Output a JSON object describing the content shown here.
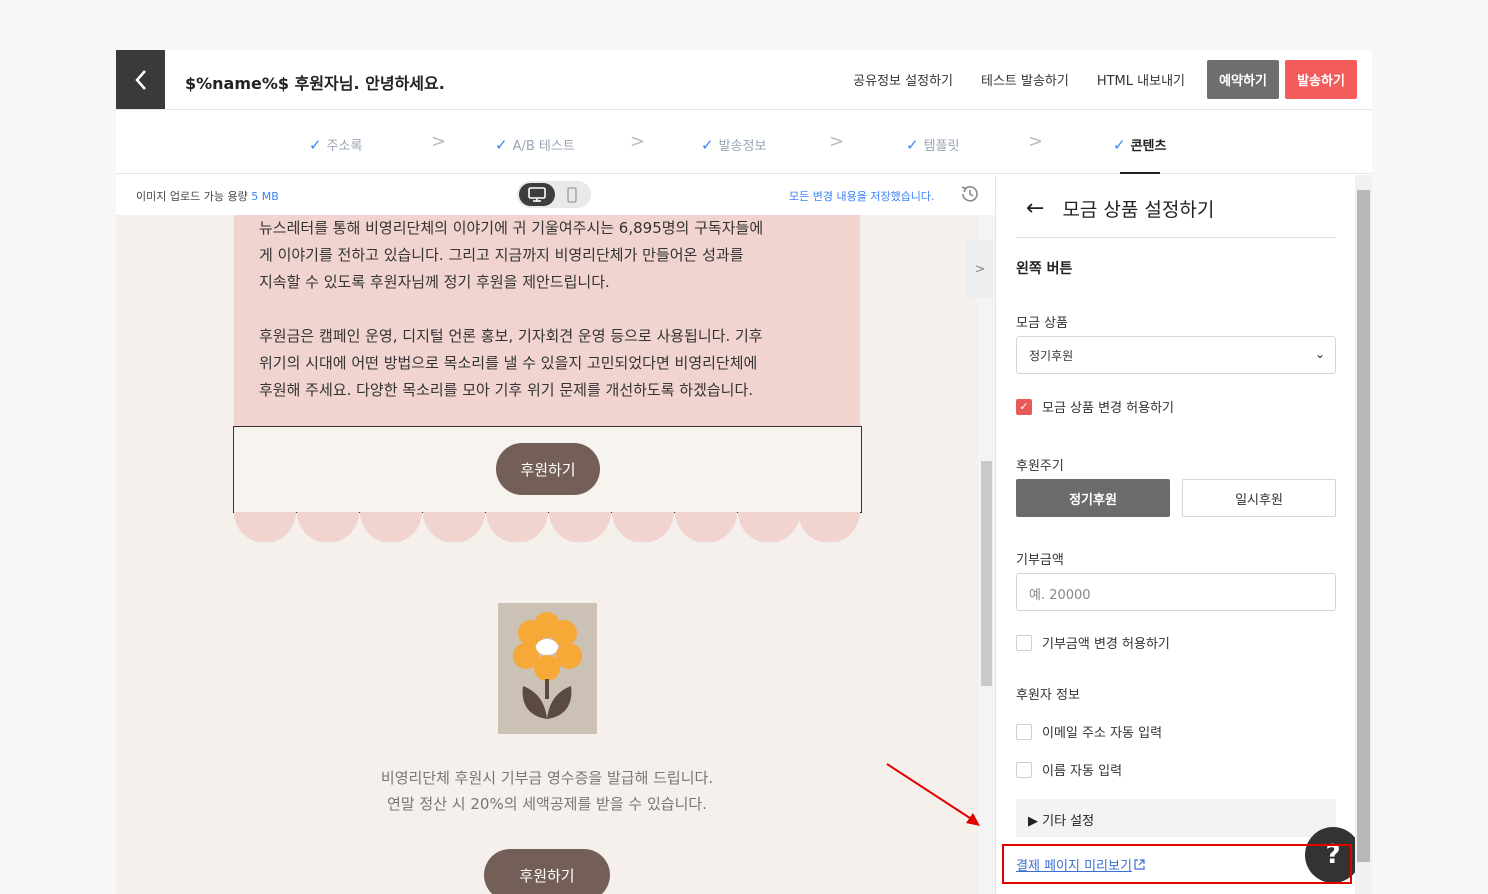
{
  "header": {
    "title": "$%name%$ 후원자님. 안녕하세요.",
    "actions": {
      "share_settings": "공유정보 설정하기",
      "test_send": "테스트 발송하기",
      "export_html": "HTML 내보내기",
      "reserve": "예약하기",
      "send": "발송하기"
    }
  },
  "steps": [
    {
      "label": "주소록",
      "done": true
    },
    {
      "label": "A/B 테스트",
      "done": true
    },
    {
      "label": "발송정보",
      "done": true
    },
    {
      "label": "템플릿",
      "done": true
    },
    {
      "label": "콘텐츠",
      "done": true,
      "active": true
    }
  ],
  "editor_bar": {
    "upload_label": "이미지 업로드 가능 용량",
    "upload_capacity": "5 MB",
    "saved_message": "모든 변경 내용을 저장했습니다."
  },
  "content": {
    "paragraph1": [
      "뉴스레터를 통해 비영리단체의 이야기에 귀 기울여주시는 6,895명의 구독자들에",
      "게 이야기를 전하고 있습니다. 그리고 지금까지 비영리단체가 만들어온 성과를",
      "지속할 수 있도록 후원자님께 정기 후원을 제안드립니다."
    ],
    "paragraph2": [
      "후원금은 캠페인 운영, 디지털 언론 홍보, 기자회견 운영 등으로 사용됩니다. 기후",
      "위기의 시대에 어떤 방법으로 목소리를 낼 수 있을지 고민되었다면 비영리단체에",
      "후원해 주세요. 다양한 목소리를 모아 기후 위기 문제를 개선하도록 하겠습니다."
    ],
    "donate_button": "후원하기",
    "caption": [
      "비영리단체 후원시 기부금 영수증을 발급해 드립니다.",
      "연말 정산 시 20%의 세액공제를 받을 수 있습니다."
    ],
    "donate_button_2": "후원하기"
  },
  "panel": {
    "title": "모금 상품 설정하기",
    "section": "왼쪽 버튼",
    "product_label": "모금 상품",
    "product_selected": "정기후원",
    "allow_product_change": "모금 상품 변경 허용하기",
    "allow_product_change_checked": true,
    "cycle_label": "후원주기",
    "cycle_options": [
      "정기후원",
      "일시후원"
    ],
    "cycle_selected": "정기후원",
    "amount_label": "기부금액",
    "amount_placeholder": "예. 20000",
    "allow_amount_change": "기부금액 변경 허용하기",
    "allow_amount_change_checked": false,
    "donor_info_label": "후원자 정보",
    "auto_email": "이메일 주소 자동 입력",
    "auto_email_checked": false,
    "auto_name": "이름 자동 입력",
    "auto_name_checked": false,
    "more_settings": "▶ 기타 설정",
    "preview_link": "결제 페이지 미리보기",
    "help": "?"
  },
  "colors": {
    "accent_blue": "#3b82f6",
    "send_red": "#f45b5b",
    "pink_block": "#f1d4d0",
    "donate_brown": "#735f57",
    "annotation_red": "#e00000"
  }
}
